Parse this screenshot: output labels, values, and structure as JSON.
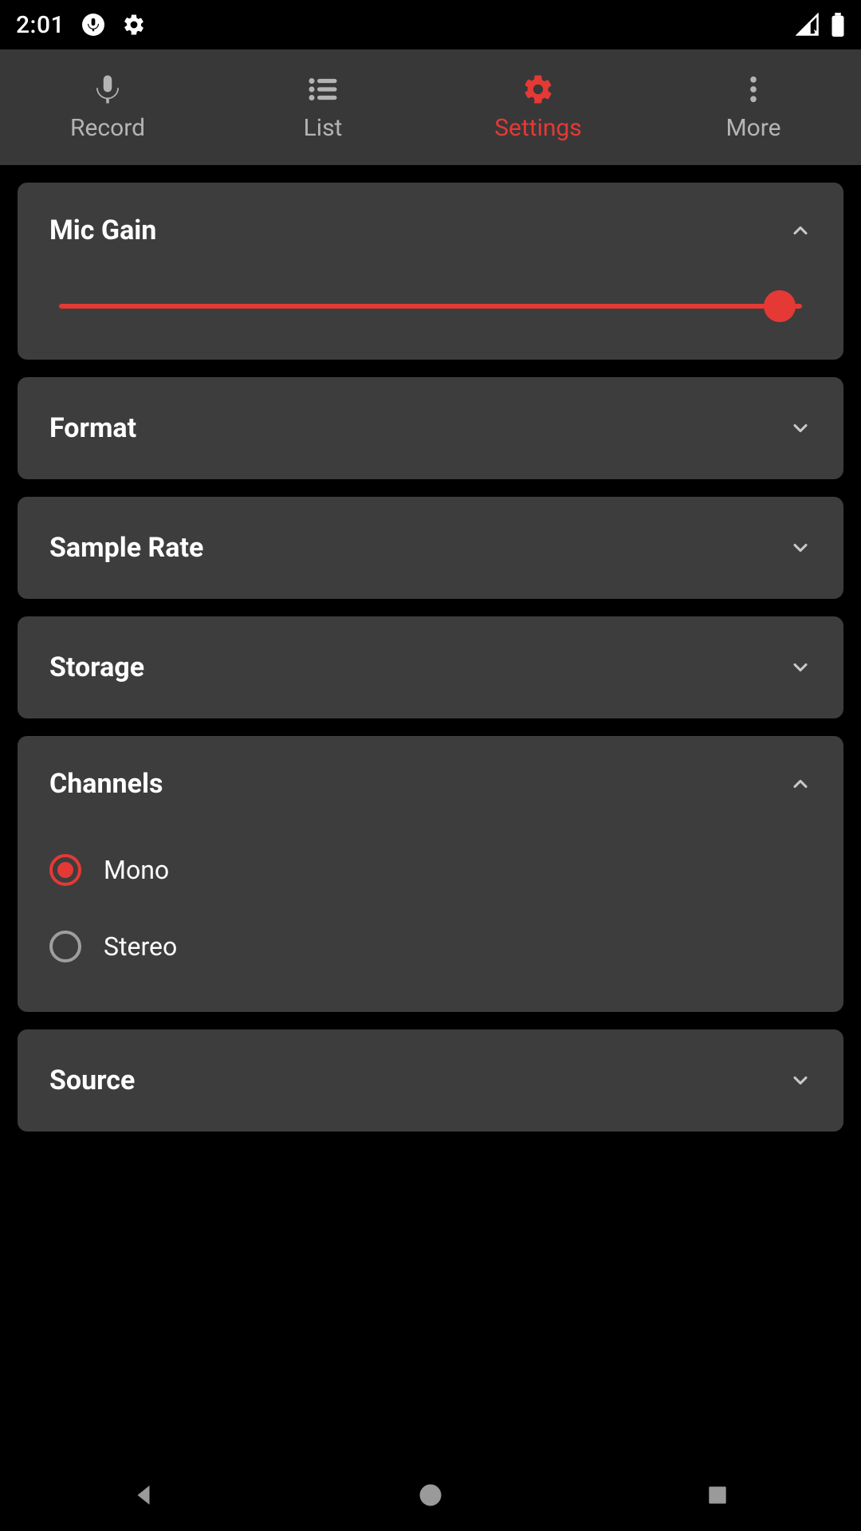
{
  "colors": {
    "accent": "#E53935",
    "bg_card": "#3D3D3D",
    "bg_tabbar": "#383838",
    "text_inactive": "#B4B4B4"
  },
  "status": {
    "time": "2:01"
  },
  "tabs": {
    "record": "Record",
    "list": "List",
    "settings": "Settings",
    "more": "More",
    "active": "settings"
  },
  "settings": {
    "mic_gain": {
      "title": "Mic Gain",
      "expanded": true,
      "value_percent": 97
    },
    "format": {
      "title": "Format",
      "expanded": false
    },
    "sample_rate": {
      "title": "Sample Rate",
      "expanded": false
    },
    "storage": {
      "title": "Storage",
      "expanded": false
    },
    "channels": {
      "title": "Channels",
      "expanded": true,
      "options": {
        "mono": "Mono",
        "stereo": "Stereo"
      },
      "selected": "mono"
    },
    "source": {
      "title": "Source",
      "expanded": false
    }
  }
}
